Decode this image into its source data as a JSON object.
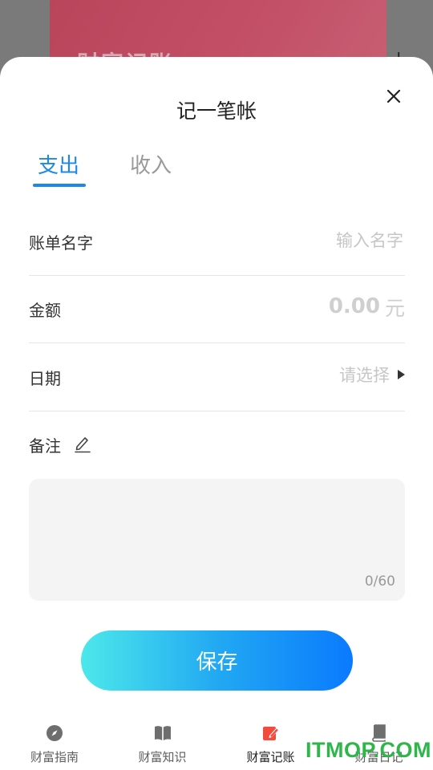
{
  "background": {
    "card_title": "财富记账"
  },
  "sheet": {
    "title": "记一笔帐"
  },
  "tabs": [
    {
      "label": "支出",
      "active": true
    },
    {
      "label": "收入",
      "active": false
    }
  ],
  "form": {
    "name_label": "账单名字",
    "name_placeholder": "输入名字",
    "amount_label": "金额",
    "amount_placeholder": "0.00",
    "amount_unit": "元",
    "date_label": "日期",
    "date_placeholder": "请选择",
    "remark_label": "备注",
    "remark_counter": "0/60"
  },
  "save_label": "保存",
  "nav": [
    {
      "label": "财富指南",
      "icon": "compass-icon",
      "active": false
    },
    {
      "label": "财富知识",
      "icon": "book-icon",
      "active": false
    },
    {
      "label": "财富记账",
      "icon": "edit-note-icon",
      "active": true
    },
    {
      "label": "财富日记",
      "icon": "diary-icon",
      "active": false
    }
  ],
  "colors": {
    "accent": "#1e88ea",
    "active_nav": "#f24a3c",
    "inactive_icon": "#6e6e6e"
  },
  "watermark": "ITMOP.COM"
}
